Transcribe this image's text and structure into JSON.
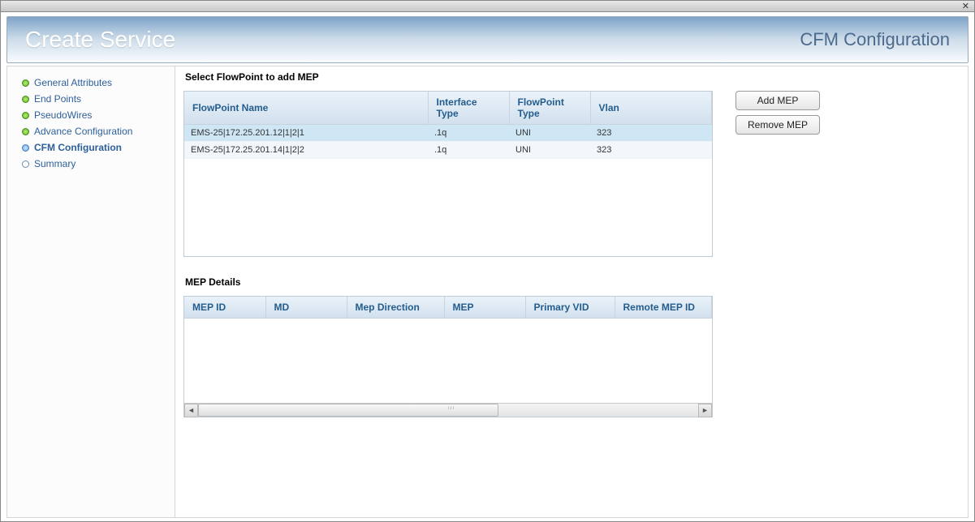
{
  "header": {
    "title": "Create Service",
    "subtitle": "CFM Configuration"
  },
  "nav": [
    {
      "label": "General Attributes",
      "state": "done"
    },
    {
      "label": "End Points",
      "state": "done"
    },
    {
      "label": "PseudoWires",
      "state": "done"
    },
    {
      "label": "Advance Configuration",
      "state": "done"
    },
    {
      "label": "CFM Configuration",
      "state": "active"
    },
    {
      "label": "Summary",
      "state": "pending"
    }
  ],
  "flowpoint": {
    "section_title": "Select FlowPoint to add MEP",
    "columns": {
      "name": "FlowPoint Name",
      "iftype": "Interface Type",
      "fptype": "FlowPoint Type",
      "vlan": "Vlan"
    },
    "rows": [
      {
        "name": "EMS-25|172.25.201.12|1|2|1",
        "iftype": ".1q",
        "fptype": "UNI",
        "vlan": "323",
        "selected": true
      },
      {
        "name": "EMS-25|172.25.201.14|1|2|2",
        "iftype": ".1q",
        "fptype": "UNI",
        "vlan": "323",
        "selected": false
      }
    ]
  },
  "buttons": {
    "add": "Add MEP",
    "remove": "Remove MEP"
  },
  "mep": {
    "section_title": "MEP Details",
    "columns": {
      "id": "MEP ID",
      "md": "MD",
      "dir": "Mep Direction",
      "mep": "MEP",
      "pvid": "Primary VID",
      "remote": "Remote MEP ID"
    }
  }
}
